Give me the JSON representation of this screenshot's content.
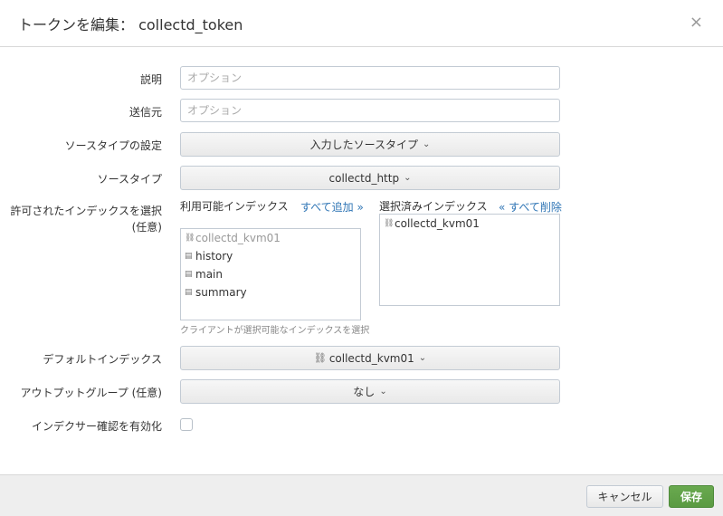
{
  "header": {
    "title": "トークンを編集： collectd_token",
    "close_label": "×"
  },
  "form": {
    "description": {
      "label": "説明",
      "placeholder": "オプション"
    },
    "source_name": {
      "label": "送信元",
      "placeholder": "オプション"
    },
    "source_type_setting": {
      "label": "ソースタイプの設定",
      "value": "入力したソースタイプ"
    },
    "source_type": {
      "label": "ソースタイプ",
      "value": "collectd_http"
    },
    "allowed_indexes": {
      "label": "許可されたインデックスを選択 (任意)",
      "available_title": "利用可能インデックス",
      "add_all": "すべて追加 »",
      "available": [
        {
          "name": "collectd_kvm01",
          "icon": "link-icon",
          "disabled": true
        },
        {
          "name": "history",
          "icon": "index-icon",
          "disabled": false
        },
        {
          "name": "main",
          "icon": "index-icon",
          "disabled": false
        },
        {
          "name": "summary",
          "icon": "index-icon",
          "disabled": false
        }
      ],
      "selected_title": "選択済みインデックス",
      "remove_all": "« すべて削除",
      "selected": [
        {
          "name": "collectd_kvm01",
          "icon": "link-icon"
        }
      ],
      "help": "クライアントが選択可能なインデックスを選択"
    },
    "default_index": {
      "label": "デフォルトインデックス",
      "value": "collectd_kvm01"
    },
    "output_group": {
      "label": "アウトプットグループ (任意)",
      "value": "なし"
    },
    "indexer_ack": {
      "label": "インデクサー確認を有効化",
      "checked": false
    }
  },
  "footer": {
    "cancel_label": "キャンセル",
    "save_label": "保存"
  },
  "colors": {
    "accent_green": "#5a9a42",
    "link_blue": "#2f75b5"
  }
}
